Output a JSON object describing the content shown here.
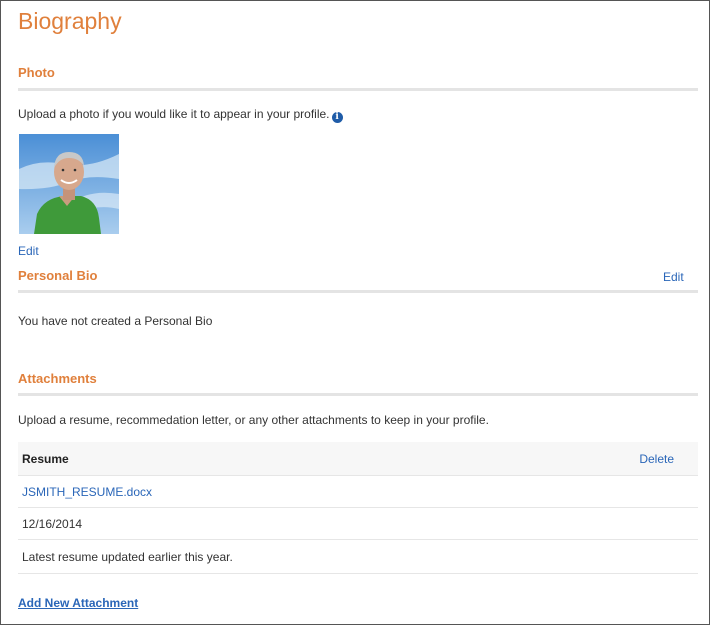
{
  "page": {
    "title": "Biography"
  },
  "photo_section": {
    "title": "Photo",
    "description": "Upload a photo if you would like it to appear in your profile.",
    "info_icon": "i",
    "edit_label": "Edit"
  },
  "bio_section": {
    "title": "Personal Bio",
    "edit_label": "Edit",
    "empty_text": "You have not created a Personal Bio"
  },
  "attachments_section": {
    "title": "Attachments",
    "description": "Upload a resume, recommedation letter, or any other attachments to keep in your profile.",
    "header_label": "Resume",
    "delete_label": "Delete",
    "file_name": "JSMITH_RESUME.docx",
    "date": "12/16/2014",
    "note": "Latest resume updated earlier this year.",
    "add_label": "Add New Attachment"
  },
  "colors": {
    "accent": "#e0803c",
    "link": "#2a66b8",
    "info_icon": "#1f5ca8"
  }
}
